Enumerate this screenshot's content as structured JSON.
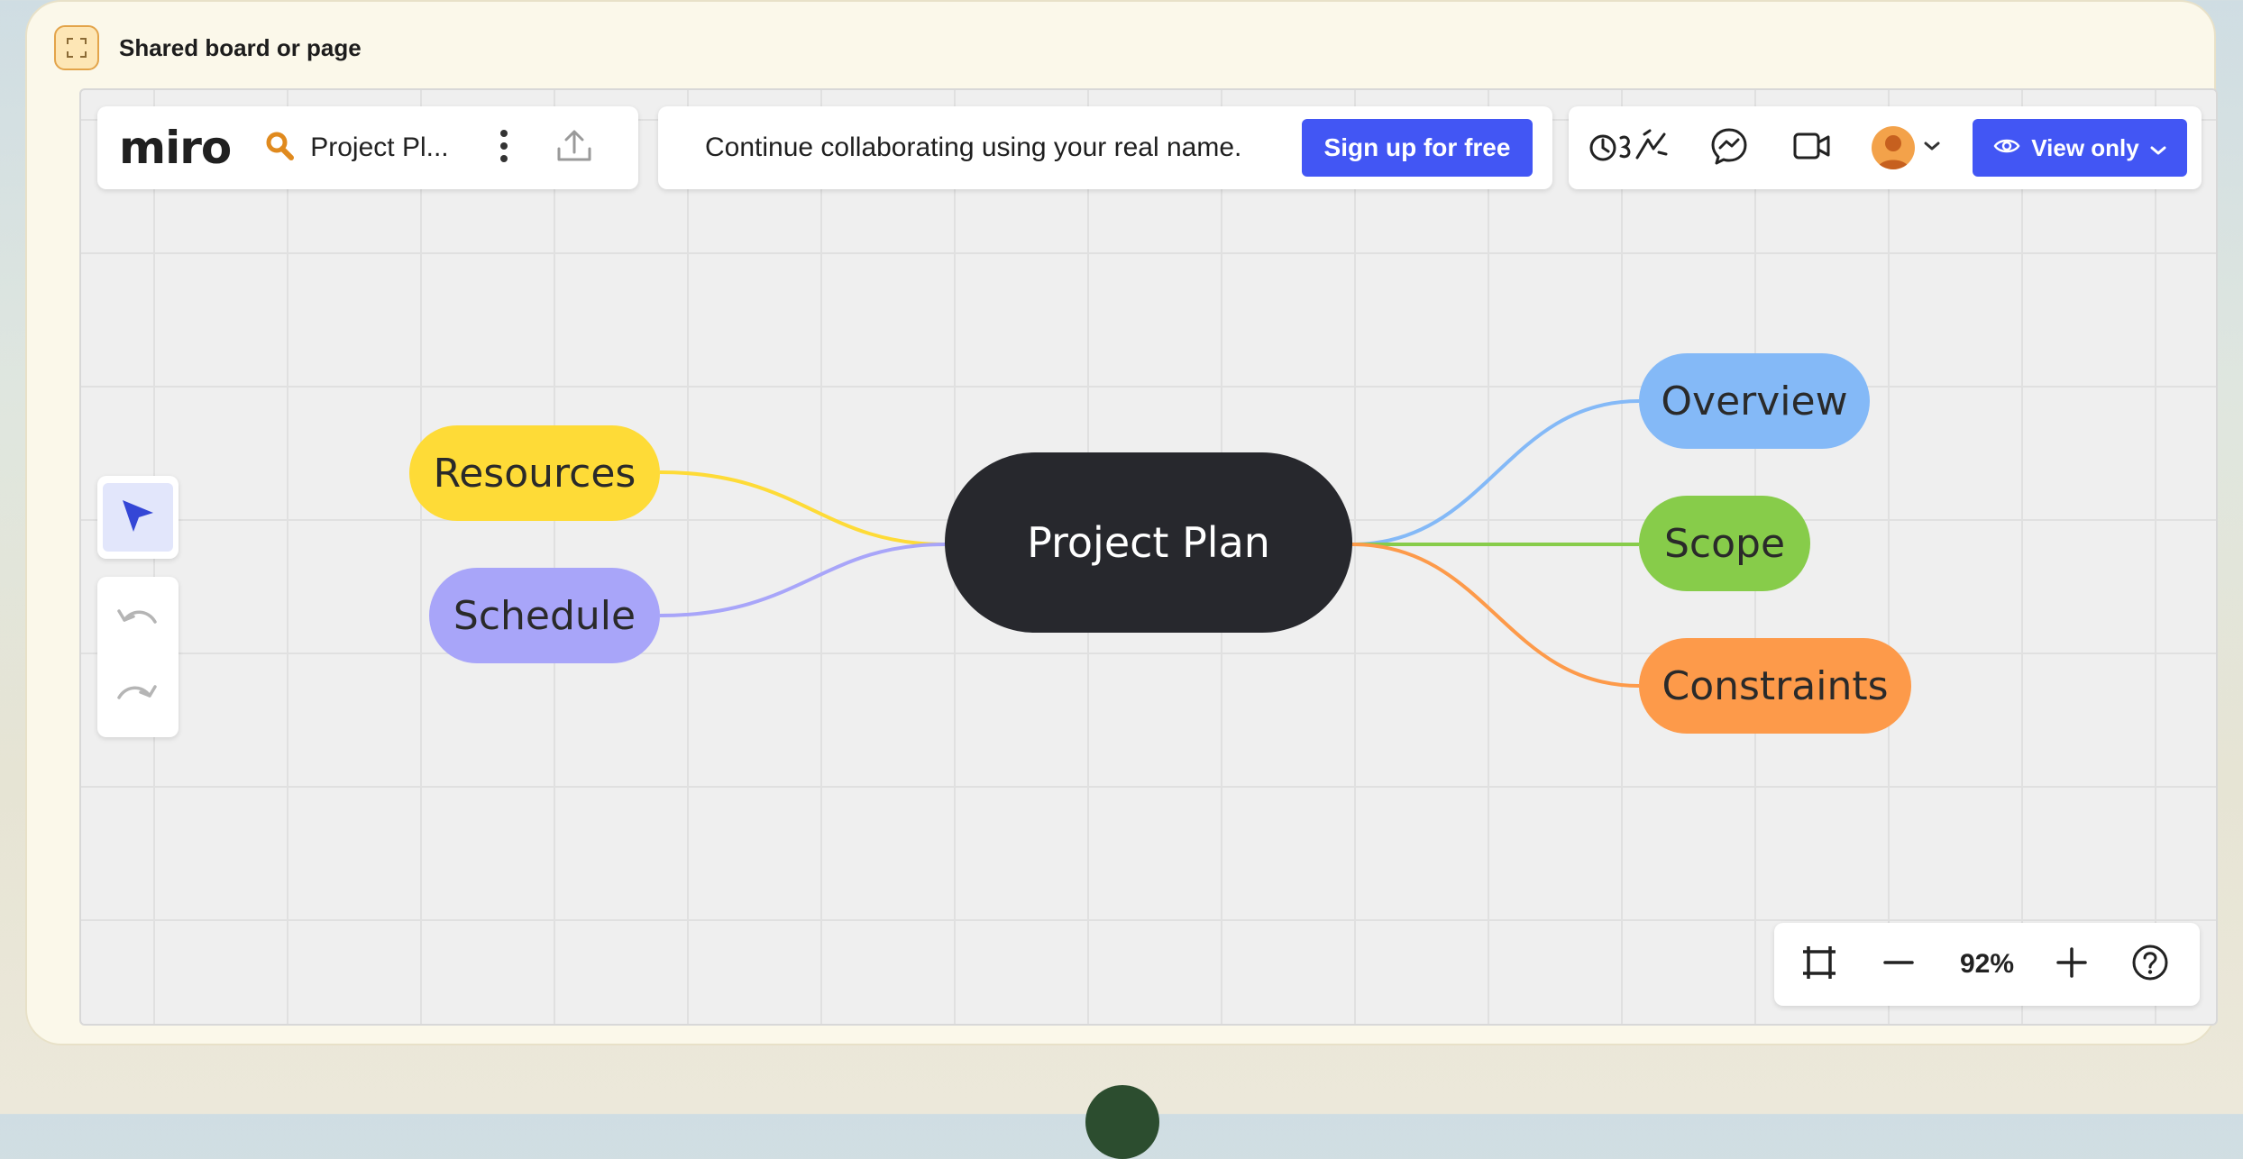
{
  "card": {
    "title": "Shared board or page",
    "expand_icon": "expand-icon"
  },
  "toolbar": {
    "logo": "miro",
    "board_name": "Project Pl...",
    "collab_message": "Continue collaborating using your real name.",
    "signup_label": "Sign up for free",
    "view_label": "View only"
  },
  "zoom": {
    "level": "92%"
  },
  "mindmap": {
    "center": "Project Plan",
    "left_nodes": [
      "Resources",
      "Schedule"
    ],
    "right_nodes": [
      "Overview",
      "Scope",
      "Constraints"
    ]
  },
  "colors": {
    "accent": "#4256f4",
    "center_node": "#27282d",
    "resources": "#fedb37",
    "schedule": "#a8a5f9",
    "overview": "#84b9f7",
    "scope": "#87cc4a",
    "constraints": "#fd9a4a"
  }
}
